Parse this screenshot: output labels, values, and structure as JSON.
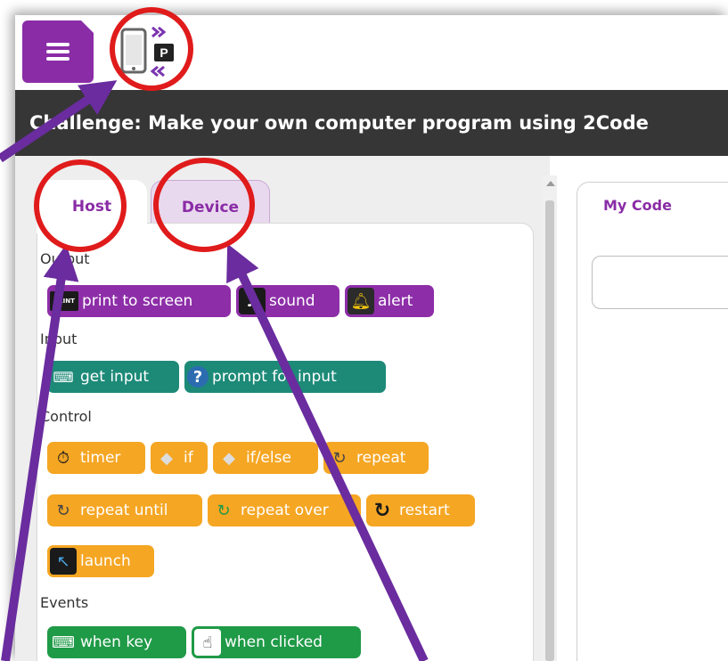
{
  "header": {
    "menu_icon": "hamburger-menu-icon",
    "connection_icon": "device-connection-icon",
    "connection_letter": "P",
    "title": "Challenge: Make your own computer program using 2Code"
  },
  "tabs": [
    {
      "label": "Host",
      "selected": true
    },
    {
      "label": "Device",
      "selected": false
    }
  ],
  "palette": {
    "categories": [
      "Output",
      "Input",
      "Control",
      "Events"
    ],
    "output": [
      "print to screen",
      "sound",
      "alert"
    ],
    "print_icon_text": "PRINT",
    "input": [
      "get input",
      "prompt for input"
    ],
    "control": [
      "timer",
      "if",
      "if/else",
      "repeat",
      "repeat until",
      "repeat over",
      "restart",
      "launch"
    ],
    "events": [
      "when key",
      "when clicked"
    ]
  },
  "code_panel": {
    "title": "My Code"
  },
  "colors": {
    "accent": "#8a2ca6",
    "title_bar": "#363636",
    "output_blocks": "#8d2ea8",
    "input_blocks": "#1d8a78",
    "control_blocks": "#f5a623",
    "event_blocks": "#1f9a47",
    "annotation_circle": "#e01b1b",
    "annotation_arrow": "#6a2c9e"
  }
}
